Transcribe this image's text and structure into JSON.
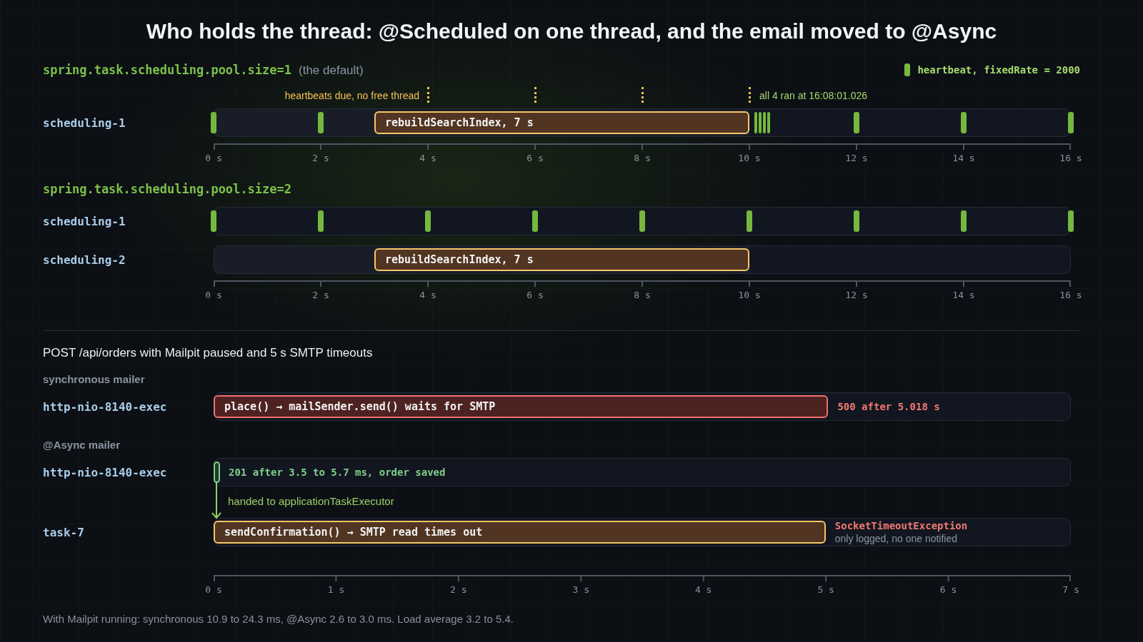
{
  "title": "Who holds the thread: @Scheduled on one thread, and the email moved to @Async",
  "legend": {
    "label": "heartbeat, fixedRate = 2000",
    "color": "#76b83e"
  },
  "panels": [
    {
      "kind": "config",
      "heading": "spring.task.scheduling.pool.size=1",
      "note": "(the default)",
      "missed_note": "heartbeats due, no free thread",
      "burst_note": "all 4 ran at 16:08:01.026",
      "lanes": [
        {
          "name": "scheduling-1",
          "beats": [
            {
              "delayed": false
            },
            {
              "delayed": false
            },
            {
              "delayed": true
            },
            {
              "delayed": true
            },
            {
              "delayed": true
            },
            {
              "delayed": true
            },
            {
              "delayed": false
            },
            {
              "delayed": false
            },
            {
              "delayed": false
            }
          ],
          "bar": {
            "kind": "span",
            "label": "rebuildSearchIndex, 7 s",
            "color": "#f6c66a",
            "level": 0.625,
            "part": {
              "level": 0.4375
            }
          }
        }
      ],
      "ticks": [
        "0 s",
        "2 s",
        "4 s",
        "6 s",
        "8 s",
        "10 s",
        "12 s",
        "14 s",
        "16 s"
      ]
    },
    {
      "kind": "config",
      "heading": "spring.task.scheduling.pool.size=2",
      "lanes": [
        {
          "name": "scheduling-1",
          "beats": [
            {
              "delayed": false
            },
            {
              "delayed": false
            },
            {
              "delayed": false
            },
            {
              "delayed": false
            },
            {
              "delayed": false
            },
            {
              "delayed": false
            },
            {
              "delayed": false
            },
            {
              "delayed": false
            },
            {
              "delayed": false
            }
          ]
        },
        {
          "name": "scheduling-2",
          "bar": {
            "kind": "span",
            "label": "rebuildSearchIndex, 7 s",
            "color": "#f6c66a",
            "level": 0.625,
            "part": {
              "level": 0.4375
            }
          }
        }
      ],
      "ticks": [
        "0 s",
        "2 s",
        "4 s",
        "6 s",
        "8 s",
        "10 s",
        "12 s",
        "14 s",
        "16 s"
      ]
    },
    {
      "kind": "scenario",
      "heading": "POST /api/orders with Mailpit paused and 5 s SMTP timeouts",
      "lanes": [
        {
          "group": "synchronous mailer",
          "name": "http-nio-8140-exec",
          "bar": {
            "kind": "fill",
            "label": "place() → mailSender.send() waits for SMTP",
            "color": "#f07070",
            "level": 0.717
          },
          "result": {
            "label": "500 after 5.018 s"
          }
        },
        {
          "group": "@Async mailer",
          "name": "http-nio-8140-exec",
          "bar": {
            "kind": "instant",
            "label": "201 after 3.5 to 5.7 ms, order saved",
            "color": "#7fd08a"
          },
          "handoff": "handed to applicationTaskExecutor"
        },
        {
          "name": "task-7",
          "bar": {
            "kind": "fill",
            "label": "sendConfirmation() → SMTP read times out",
            "color": "#f6c66a",
            "level": 0.714
          },
          "result": {
            "label": "SocketTimeoutException",
            "detail": "only logged, no one notified"
          }
        }
      ],
      "ticks": [
        "0 s",
        "1 s",
        "2 s",
        "3 s",
        "4 s",
        "5 s",
        "6 s",
        "7 s"
      ]
    }
  ],
  "footer": "With Mailpit running: synchronous 10.9 to 24.3 ms, @Async 2.6 to 3.0 ms. Load average 3.2 to 5.4."
}
